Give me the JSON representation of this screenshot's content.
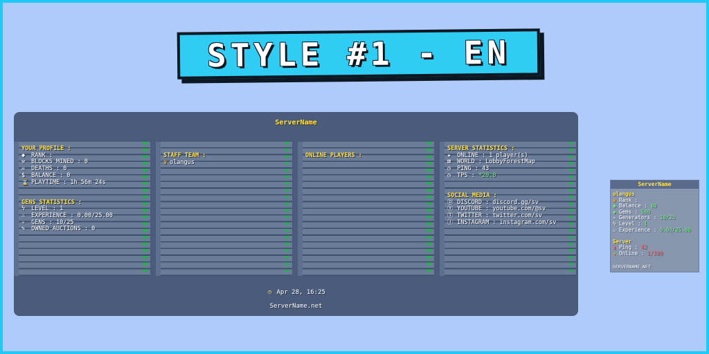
{
  "banner": {
    "title": "STYLE #1 - EN"
  },
  "tablist": {
    "title": "ServerName",
    "profile": {
      "header": "YOUR PROFILE :",
      "rows": [
        {
          "icon": "diamond-icon",
          "glyph": "◆",
          "text": "RANK :"
        },
        {
          "icon": "pickaxe-icon",
          "glyph": "⚒",
          "text": "BLOCKS MINED : 0"
        },
        {
          "icon": "skull-icon",
          "glyph": "☠",
          "text": "DEATHS : 0"
        },
        {
          "icon": "dollar-icon",
          "glyph": "$",
          "text": "BALANCE : 0"
        },
        {
          "icon": "hourglass-icon",
          "glyph": "⌛",
          "text": "PLAYTIME : 1h 56m 24s"
        }
      ]
    },
    "gens": {
      "header": "GENS STATISTICS :",
      "rows": [
        {
          "icon": "lightning-icon",
          "glyph": "ϟ",
          "text": "LEVEL : 1"
        },
        {
          "icon": "flask-icon",
          "glyph": "♨",
          "text": "EXPERIENCE : 0.00/25.00"
        },
        {
          "icon": "sparkle-icon",
          "glyph": "✧",
          "text": "GENS : 10/25"
        },
        {
          "icon": "hammer-icon",
          "glyph": "✎",
          "text": "OWNED AUCTIONS : 0"
        }
      ]
    },
    "staff": {
      "header": "STAFF TEAM :",
      "member": "olangus"
    },
    "online": {
      "header": "ONLINE PLAYERS :"
    },
    "server": {
      "header": "SERVER STATISTICS :",
      "online_label": "ONLINE : ",
      "online_value": "1 player(s)",
      "world": "WORLD : LobbyForestMap",
      "ping": "PING : 43",
      "tps_label": "TPS : ",
      "tps_value": "*20.0"
    },
    "social": {
      "header": "SOCIAL MEDIA :",
      "rows": [
        {
          "icon": "discord-icon",
          "glyph": "Ⓓ",
          "text": "DISCORD : discord.gg/sv"
        },
        {
          "icon": "youtube-icon",
          "glyph": "Ⓨ",
          "text": "YOUTUBE : youtube.com/@sv"
        },
        {
          "icon": "twitter-icon",
          "glyph": "Ⓣ",
          "text": "TWITTER : twitter.com/sv"
        },
        {
          "icon": "instagram-icon",
          "glyph": "Ⓘ",
          "text": "INSTAGRAM : instagram.com/sv"
        }
      ]
    },
    "footer": {
      "time": "Apr 28, 16:25",
      "site": "ServerName.net"
    }
  },
  "scoreboard": {
    "title": "ServerName",
    "player": "olangus",
    "rank": "Rank :",
    "balance_label": "Balance : ",
    "balance_value": "$0",
    "gems_label": "Gems : ",
    "gems_value": "500",
    "generators_label": "Generators : ",
    "generators_value": "10/25",
    "level_label": "Level : ",
    "level_value": "1",
    "experience_label": "Experience : ",
    "experience_value": "0.00/25.00",
    "server_header": "Server",
    "ping_label": "Ping : ",
    "ping_value": "43",
    "online_label": "Online : ",
    "online_value": "1/100",
    "site": "SERVERNAME.NET"
  },
  "colors": {
    "accent": "#1fc9f5",
    "header_yellow": "#ffe24a",
    "value_green": "#6df07a",
    "panel": "#4a5b7c"
  }
}
